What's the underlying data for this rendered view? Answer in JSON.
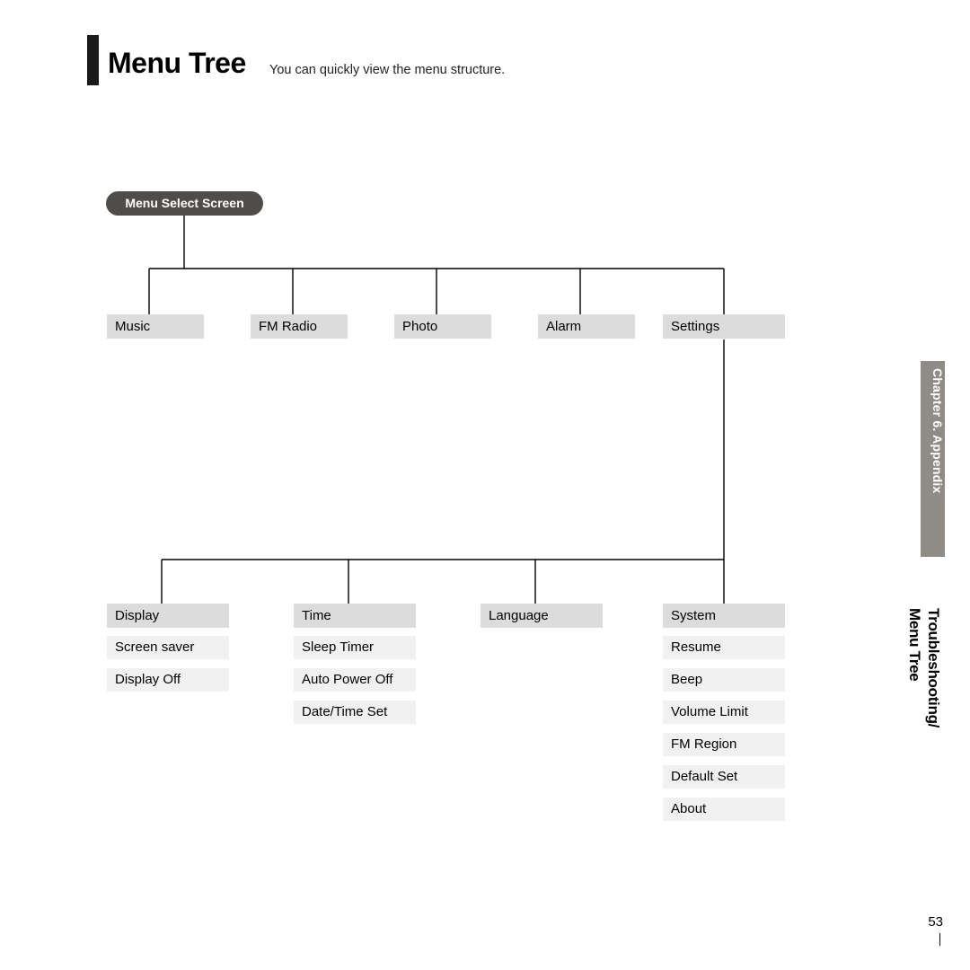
{
  "header": {
    "title": "Menu Tree",
    "subtitle": "You can quickly view the menu structure."
  },
  "root": {
    "label": "Menu Select Screen"
  },
  "level1": [
    {
      "label": "Music"
    },
    {
      "label": "FM Radio"
    },
    {
      "label": "Photo"
    },
    {
      "label": "Alarm"
    },
    {
      "label": "Settings"
    }
  ],
  "settings_children": [
    {
      "label": "Display",
      "subs": [
        "Screen saver",
        "Display Off"
      ]
    },
    {
      "label": "Time",
      "subs": [
        "Sleep Timer",
        "Auto Power Off",
        "Date/Time Set"
      ]
    },
    {
      "label": "Language",
      "subs": []
    },
    {
      "label": "System",
      "subs": [
        "Resume",
        "Beep",
        "Volume Limit",
        "FM Region",
        "Default Set",
        "About"
      ]
    }
  ],
  "side": {
    "chapter": "Chapter 6.  Appendix",
    "section1": "Troubleshooting/",
    "section2": "Menu Tree"
  },
  "page_number": "53"
}
